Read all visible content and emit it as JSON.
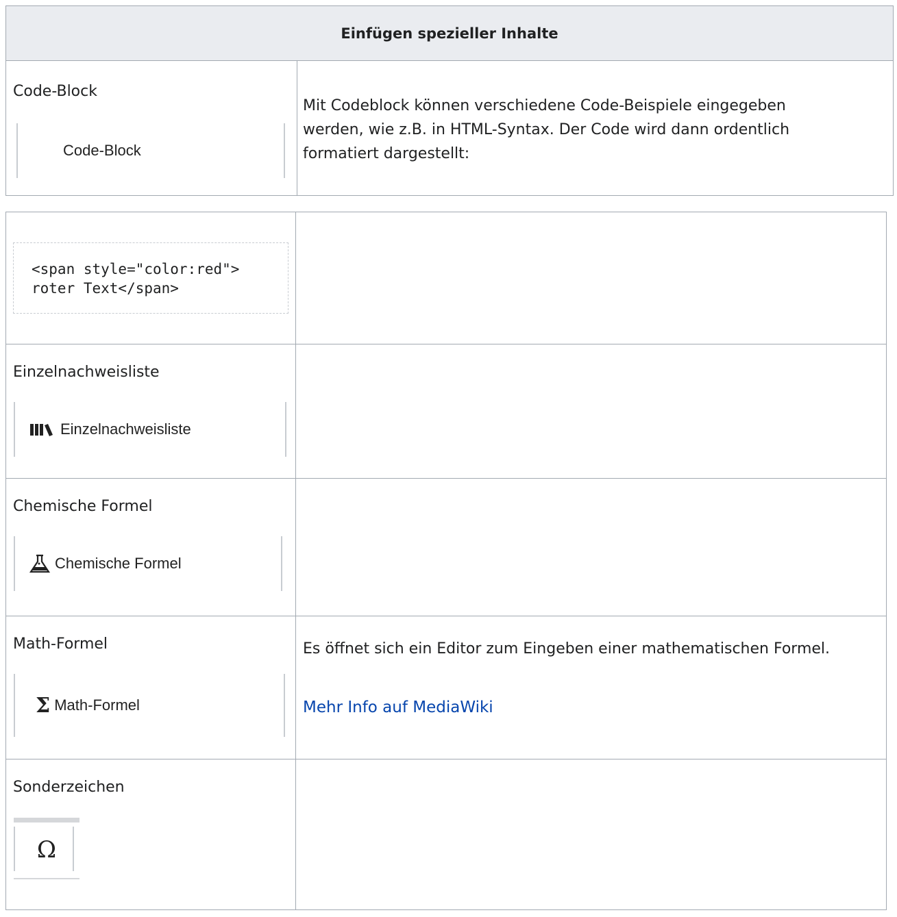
{
  "table_top": {
    "title": "Einfügen spezieller Inhalte",
    "rows": [
      {
        "label": "Code-Block",
        "button_label": "Code-Block",
        "description": "Mit Codeblock können verschiedene Code-Beispiele eingegeben werden, wie z.B. in HTML-Syntax. Der Code wird dann ordentlich formatiert dargestellt:"
      }
    ]
  },
  "table_bottom": {
    "code_example": "<span style=\"color:red\">\nroter Text</span>",
    "rows": [
      {
        "label": "Einzelnachweisliste",
        "button_label": "Einzelnachweisliste",
        "icon": "books-icon"
      },
      {
        "label": "Chemische Formel",
        "button_label": "Chemische Formel",
        "icon": "flask-icon"
      },
      {
        "label": "Math-Formel",
        "button_label": "Math-Formel",
        "icon": "sigma-icon",
        "description": "Es öffnet sich ein Editor zum Eingeben einer mathematischen Formel.",
        "link": "Mehr Info auf MediaWiki"
      },
      {
        "label": "Sonderzeichen",
        "icon": "omega-icon",
        "glyph": "Ω"
      }
    ]
  },
  "colors": {
    "border": "#a2a9b1",
    "header_bg": "#eaecf0",
    "link": "#0645ad"
  }
}
